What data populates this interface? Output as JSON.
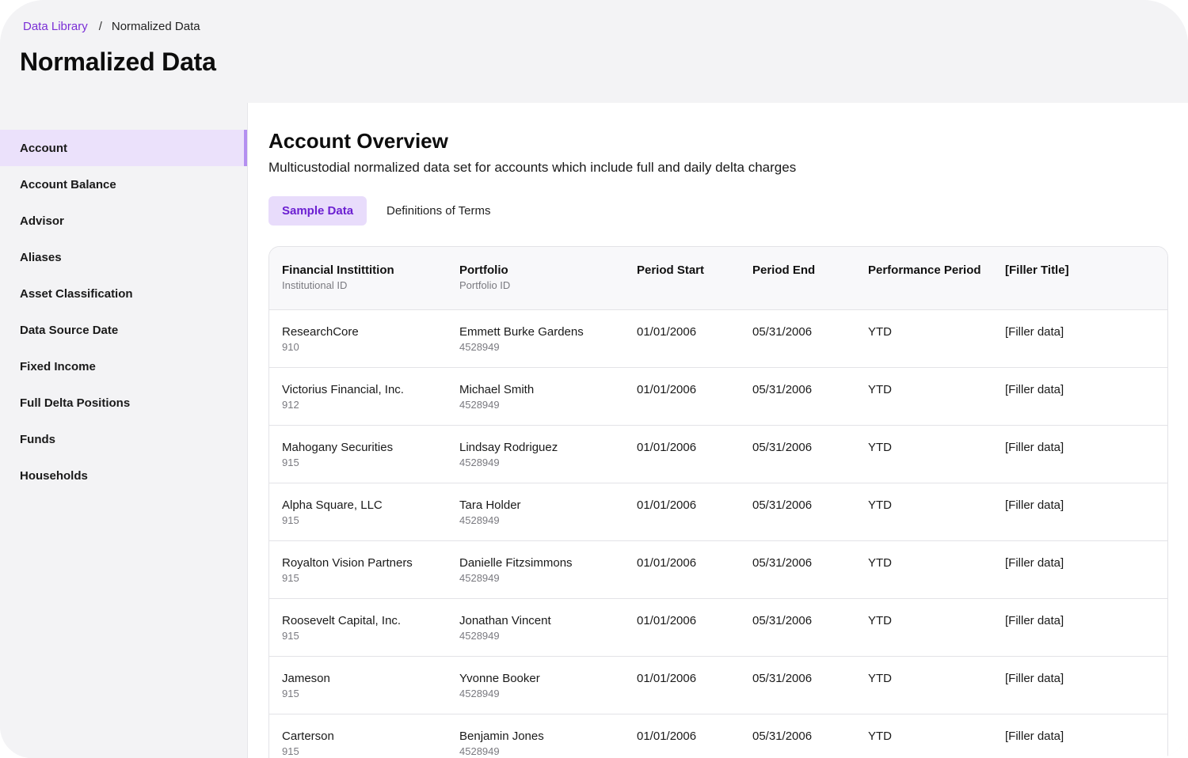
{
  "breadcrumb": {
    "parent": "Data Library",
    "separator": "/",
    "current": "Normalized Data"
  },
  "page_title": "Normalized Data",
  "sidebar": {
    "items": [
      {
        "label": "Account",
        "active": true
      },
      {
        "label": "Account Balance"
      },
      {
        "label": "Advisor"
      },
      {
        "label": "Aliases"
      },
      {
        "label": "Asset Classification"
      },
      {
        "label": "Data Source Date"
      },
      {
        "label": "Fixed Income"
      },
      {
        "label": "Full Delta Positions"
      },
      {
        "label": "Funds"
      },
      {
        "label": "Households"
      }
    ]
  },
  "main": {
    "title": "Account Overview",
    "description": "Multicustodial normalized data set for accounts which include full and daily delta charges",
    "tabs": [
      {
        "label": "Sample Data",
        "active": true
      },
      {
        "label": "Definitions of Terms"
      }
    ]
  },
  "table": {
    "columns": [
      {
        "label": "Financial Instittition",
        "sub": "Institutional ID"
      },
      {
        "label": "Portfolio",
        "sub": "Portfolio ID"
      },
      {
        "label": "Period Start"
      },
      {
        "label": "Period End"
      },
      {
        "label": "Performance Period"
      },
      {
        "label": "[Filler Title]"
      }
    ],
    "rows": [
      {
        "institution": "ResearchCore",
        "institution_id": "910",
        "portfolio": "Emmett Burke Gardens",
        "portfolio_id": "4528949",
        "start": "01/01/2006",
        "end": "05/31/2006",
        "period": "YTD",
        "filler": "[Filler data]"
      },
      {
        "institution": "Victorius Financial, Inc.",
        "institution_id": "912",
        "portfolio": "Michael Smith",
        "portfolio_id": "4528949",
        "start": "01/01/2006",
        "end": "05/31/2006",
        "period": "YTD",
        "filler": "[Filler data]"
      },
      {
        "institution": "Mahogany Securities",
        "institution_id": "915",
        "portfolio": "Lindsay Rodriguez",
        "portfolio_id": "4528949",
        "start": "01/01/2006",
        "end": "05/31/2006",
        "period": "YTD",
        "filler": "[Filler data]"
      },
      {
        "institution": "Alpha Square, LLC",
        "institution_id": "915",
        "portfolio": "Tara Holder",
        "portfolio_id": "4528949",
        "start": "01/01/2006",
        "end": "05/31/2006",
        "period": "YTD",
        "filler": "[Filler data]"
      },
      {
        "institution": "Royalton Vision Partners",
        "institution_id": "915",
        "portfolio": "Danielle Fitzsimmons",
        "portfolio_id": "4528949",
        "start": "01/01/2006",
        "end": "05/31/2006",
        "period": "YTD",
        "filler": "[Filler data]"
      },
      {
        "institution": "Roosevelt Capital, Inc.",
        "institution_id": "915",
        "portfolio": "Jonathan Vincent",
        "portfolio_id": "4528949",
        "start": "01/01/2006",
        "end": "05/31/2006",
        "period": "YTD",
        "filler": "[Filler data]"
      },
      {
        "institution": "Jameson",
        "institution_id": "915",
        "portfolio": "Yvonne Booker",
        "portfolio_id": "4528949",
        "start": "01/01/2006",
        "end": "05/31/2006",
        "period": "YTD",
        "filler": "[Filler data]"
      },
      {
        "institution": "Carterson",
        "institution_id": "915",
        "portfolio": "Benjamin Jones",
        "portfolio_id": "4528949",
        "start": "01/01/2006",
        "end": "05/31/2006",
        "period": "YTD",
        "filler": "[Filler data]"
      }
    ]
  },
  "colors": {
    "accent": "#7b2fd6",
    "active_bg": "#ebe1fb",
    "panel_bg": "#f3f3f5",
    "border": "#e3e3e7"
  }
}
